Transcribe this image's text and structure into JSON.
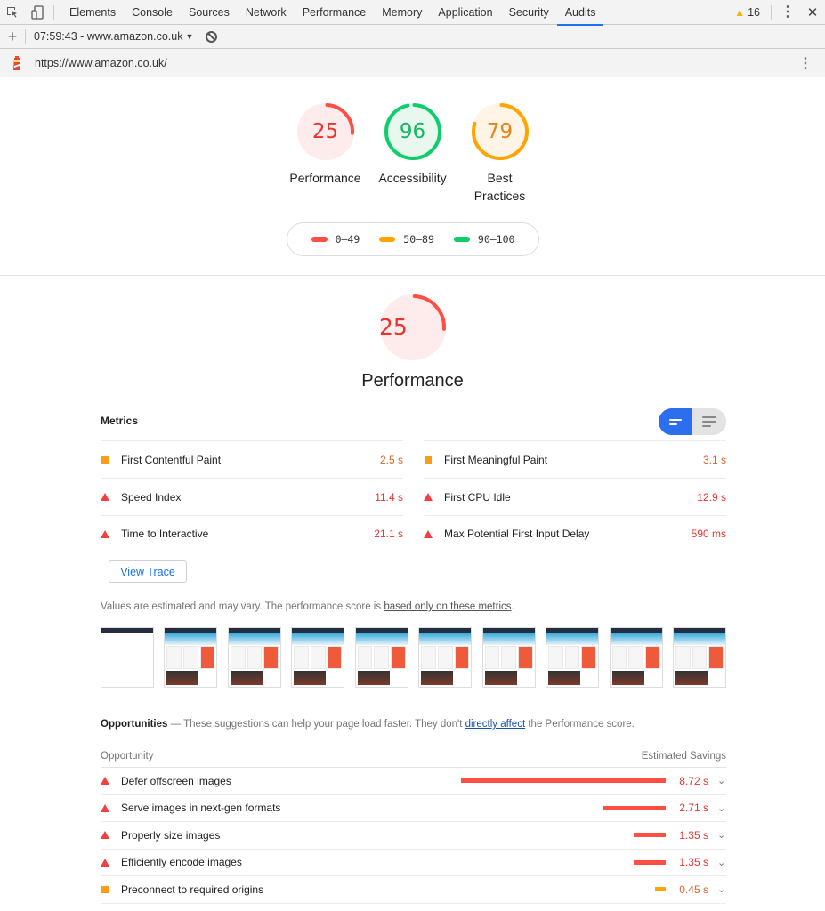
{
  "devtools": {
    "tabs": [
      {
        "label": "Elements",
        "active": false
      },
      {
        "label": "Console",
        "active": false
      },
      {
        "label": "Sources",
        "active": false
      },
      {
        "label": "Network",
        "active": false
      },
      {
        "label": "Performance",
        "active": false
      },
      {
        "label": "Memory",
        "active": false
      },
      {
        "label": "Application",
        "active": false
      },
      {
        "label": "Security",
        "active": false
      },
      {
        "label": "Audits",
        "active": true
      }
    ],
    "warnings_count": "16",
    "report_select": "07:59:43 - www.amazon.co.uk",
    "url": "https://www.amazon.co.uk/"
  },
  "colors": {
    "fail": "#ff4e42",
    "average": "#ffa400",
    "pass": "#0cce6b",
    "accent": "#1a73e8"
  },
  "summary": {
    "gauges": [
      {
        "label": "Performance",
        "score": 25,
        "rating": "fail"
      },
      {
        "label": "Accessibility",
        "score": 96,
        "rating": "pass"
      },
      {
        "label": "Best Practices",
        "score": 79,
        "rating": "average"
      }
    ],
    "legend": [
      {
        "range": "0–49",
        "rating": "fail"
      },
      {
        "range": "50–89",
        "rating": "average"
      },
      {
        "range": "90–100",
        "rating": "pass"
      }
    ]
  },
  "performance": {
    "score": 25,
    "title": "Performance",
    "metrics_heading": "Metrics",
    "metrics_left": [
      {
        "name": "First Contentful Paint",
        "value": "2.5 s",
        "rating": "average"
      },
      {
        "name": "Speed Index",
        "value": "11.4 s",
        "rating": "fail"
      },
      {
        "name": "Time to Interactive",
        "value": "21.1 s",
        "rating": "fail"
      }
    ],
    "metrics_right": [
      {
        "name": "First Meaningful Paint",
        "value": "3.1 s",
        "rating": "average"
      },
      {
        "name": "First CPU Idle",
        "value": "12.9 s",
        "rating": "fail"
      },
      {
        "name": "Max Potential First Input Delay",
        "value": "590 ms",
        "rating": "fail"
      }
    ],
    "view_trace_label": "View Trace",
    "note_text": "Values are estimated and may vary. The performance score is ",
    "note_link": "based only on these metrics",
    "note_end": ".",
    "filmstrip_frames": 10
  },
  "opportunities": {
    "heading": "Opportunities",
    "dash": " — ",
    "description": "These suggestions can help your page load faster. They don't ",
    "link": "directly affect",
    "description_end": " the Performance score.",
    "col_opportunity": "Opportunity",
    "col_savings": "Estimated Savings",
    "items": [
      {
        "name": "Defer offscreen images",
        "savings_s": 8.72,
        "savings": "8.72 s",
        "rating": "fail"
      },
      {
        "name": "Serve images in next-gen formats",
        "savings_s": 2.71,
        "savings": "2.71 s",
        "rating": "fail"
      },
      {
        "name": "Properly size images",
        "savings_s": 1.35,
        "savings": "1.35 s",
        "rating": "fail"
      },
      {
        "name": "Efficiently encode images",
        "savings_s": 1.35,
        "savings": "1.35 s",
        "rating": "fail"
      },
      {
        "name": "Preconnect to required origins",
        "savings_s": 0.45,
        "savings": "0.45 s",
        "rating": "average"
      }
    ]
  }
}
